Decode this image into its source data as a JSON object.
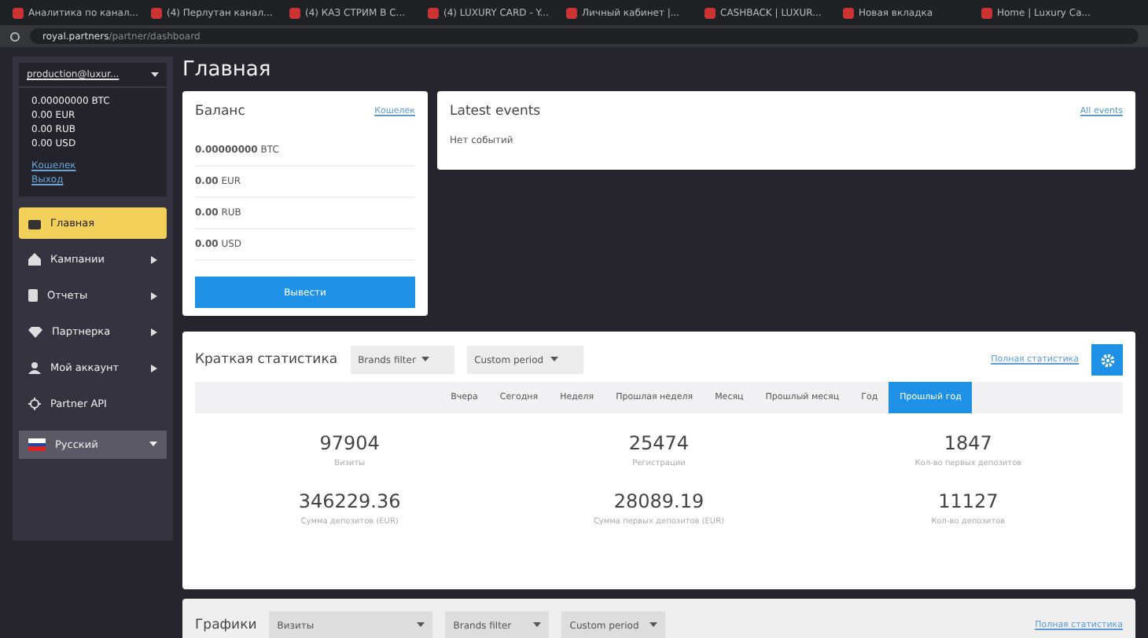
{
  "browser": {
    "tabs": [
      {
        "title": "Аналитика по канал...",
        "selected": false
      },
      {
        "title": "(4) Перлутан канал...",
        "selected": false
      },
      {
        "title": "(4) КАЗ СТРИМ В С...",
        "selected": false
      },
      {
        "title": "(4) LUXURY CARD - Y...",
        "selected": false
      },
      {
        "title": "Личный кабинет |...",
        "selected": false
      },
      {
        "title": "CASHBACK | LUXUR...",
        "selected": false
      },
      {
        "title": "Новая вкладка",
        "selected": false
      },
      {
        "title": "Home | Luxury Ca...",
        "selected": false
      }
    ],
    "url_host": "royal.partners",
    "url_path": "/partner/dashboard"
  },
  "sidebar": {
    "account": "production@luxur...",
    "balances": [
      {
        "amount": "0.00000000",
        "currency": "BTC"
      },
      {
        "amount": "0.00",
        "currency": "EUR"
      },
      {
        "amount": "0.00",
        "currency": "RUB"
      },
      {
        "amount": "0.00",
        "currency": "USD"
      }
    ],
    "links": [
      "Кошелек",
      "Выход"
    ],
    "items": [
      {
        "label": "Главная",
        "selected": true,
        "submenu": false
      },
      {
        "label": "Кампании",
        "selected": false,
        "submenu": true
      },
      {
        "label": "Отчеты",
        "selected": false,
        "submenu": true
      },
      {
        "label": "Партнерка",
        "selected": false,
        "submenu": true
      },
      {
        "label": "Мой аккаунт",
        "selected": false,
        "submenu": true
      },
      {
        "label": "Partner API",
        "selected": false,
        "submenu": false
      }
    ],
    "language": "Русский"
  },
  "page_title": "Главная",
  "balance": {
    "title": "Баланс",
    "link": "Кошелек",
    "rows": [
      {
        "amount": "0.00000000",
        "currency": "BTC"
      },
      {
        "amount": "0.00",
        "currency": "EUR"
      },
      {
        "amount": "0.00",
        "currency": "RUB"
      },
      {
        "amount": "0.00",
        "currency": "USD"
      }
    ],
    "button": "Вывести"
  },
  "events": {
    "title": "Latest events",
    "link": "All events",
    "empty": "Нет событий"
  },
  "stats": {
    "title": "Краткая статистика",
    "filters": [
      "Brands filter",
      "Custom period"
    ],
    "link": "Полная статистика",
    "periods": [
      {
        "label": "Вчера",
        "selected": false
      },
      {
        "label": "Сегодня",
        "selected": false
      },
      {
        "label": "Неделя",
        "selected": false
      },
      {
        "label": "Прошлая неделя",
        "selected": false
      },
      {
        "label": "Месяц",
        "selected": false
      },
      {
        "label": "Прошлый месяц",
        "selected": false
      },
      {
        "label": "Год",
        "selected": false
      },
      {
        "label": "Прошлый год",
        "selected": true
      }
    ],
    "metrics": [
      {
        "value": "97904",
        "label": "Визиты"
      },
      {
        "value": "25474",
        "label": "Регистрации"
      },
      {
        "value": "1847",
        "label": "Кол-во первых депозитов"
      },
      {
        "value": "346229.36",
        "label": "Сумма депозитов (EUR)"
      },
      {
        "value": "28089.19",
        "label": "Сумма первых депозитов (EUR)"
      },
      {
        "value": "11127",
        "label": "Кол-во депозитов"
      }
    ]
  },
  "charts": {
    "title": "Графики",
    "filters": [
      "Визиты",
      "Brands filter",
      "Custom period"
    ],
    "link": "Полная статистика"
  }
}
